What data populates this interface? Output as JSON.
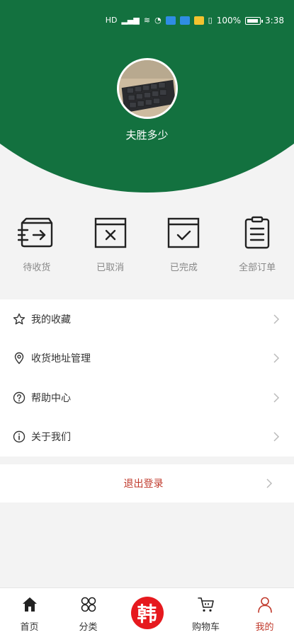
{
  "status_bar": {
    "battery_percent": "100%",
    "time": "3:38",
    "network_label": "HD"
  },
  "profile": {
    "username": "夫胜多少",
    "avatar_icon": "keyboard-photo"
  },
  "orders": [
    {
      "label": "待收货",
      "icon": "pending-delivery-icon"
    },
    {
      "label": "已取消",
      "icon": "cancelled-icon"
    },
    {
      "label": "已完成",
      "icon": "completed-icon"
    },
    {
      "label": "全部订单",
      "icon": "all-orders-icon"
    }
  ],
  "menu": [
    {
      "label": "我的收藏",
      "icon": "star-icon"
    },
    {
      "label": "收货地址管理",
      "icon": "location-pin-icon"
    },
    {
      "label": "帮助中心",
      "icon": "question-circle-icon"
    },
    {
      "label": "关于我们",
      "icon": "info-circle-icon"
    }
  ],
  "logout_label": "退出登录",
  "tabbar": {
    "items": [
      {
        "label": "首页",
        "icon": "home-icon"
      },
      {
        "label": "分类",
        "icon": "category-icon"
      },
      {
        "label": "韩",
        "icon": "brand-logo"
      },
      {
        "label": "购物车",
        "icon": "cart-icon"
      },
      {
        "label": "我的",
        "icon": "user-icon"
      }
    ],
    "active_index": 4
  },
  "colors": {
    "header_green": "#13713f",
    "accent_red": "#c0392b",
    "brand_red": "#e6191e"
  }
}
